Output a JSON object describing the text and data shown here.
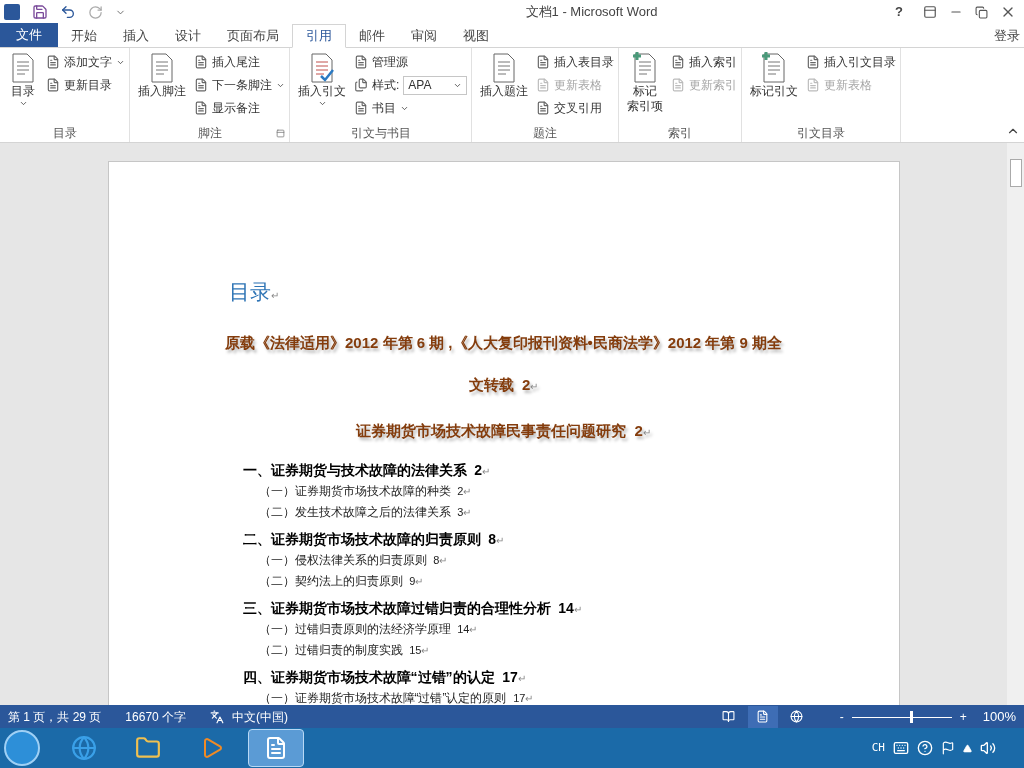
{
  "window": {
    "title": "文档1 - Microsoft Word",
    "help": "?"
  },
  "file_tab": "文件",
  "tabs": [
    {
      "label": "开始",
      "selected": false
    },
    {
      "label": "插入",
      "selected": false
    },
    {
      "label": "设计",
      "selected": false
    },
    {
      "label": "页面布局",
      "selected": false
    },
    {
      "label": "引用",
      "selected": true
    },
    {
      "label": "邮件",
      "selected": false
    },
    {
      "label": "审阅",
      "selected": false
    },
    {
      "label": "视图",
      "selected": false
    }
  ],
  "sign_in": "登录",
  "ribbon_groups": [
    {
      "label": "目录",
      "items": [
        {
          "kind": "large",
          "label_lines": [
            "目录"
          ],
          "dropdown": true
        },
        {
          "kind": "small",
          "label": "添加文字",
          "dropdown": true
        },
        {
          "kind": "small",
          "label": "更新目录"
        }
      ]
    },
    {
      "label": "脚注",
      "launcher": true,
      "items": [
        {
          "kind": "large",
          "label_lines": [
            "插入脚注"
          ]
        },
        {
          "kind": "small",
          "label": "插入尾注"
        },
        {
          "kind": "small",
          "label": "下一条脚注",
          "dropdown": true
        },
        {
          "kind": "small",
          "label": "显示备注"
        }
      ]
    },
    {
      "label": "引文与书目",
      "items": [
        {
          "kind": "large",
          "label_lines": [
            "插入引文"
          ],
          "dropdown": true
        },
        {
          "kind": "small",
          "label": "管理源"
        },
        {
          "kind": "select",
          "label": "样式:",
          "value": "APA"
        },
        {
          "kind": "small",
          "label": "书目",
          "dropdown": true
        }
      ]
    },
    {
      "label": "题注",
      "items": [
        {
          "kind": "large",
          "label_lines": [
            "插入题注"
          ]
        },
        {
          "kind": "small",
          "label": "插入表目录"
        },
        {
          "kind": "small",
          "label": "更新表格",
          "disabled": true
        },
        {
          "kind": "small",
          "label": "交叉引用"
        }
      ]
    },
    {
      "label": "索引",
      "items": [
        {
          "kind": "large",
          "label_lines": [
            "标记",
            "索引项"
          ]
        },
        {
          "kind": "small",
          "label": "插入索引"
        },
        {
          "kind": "small",
          "label": "更新索引",
          "disabled": true
        }
      ]
    },
    {
      "label": "引文目录",
      "items": [
        {
          "kind": "large",
          "label_lines": [
            "标记引文"
          ]
        },
        {
          "kind": "small",
          "label": "插入引文目录"
        },
        {
          "kind": "small",
          "label": "更新表格",
          "disabled": true
        }
      ]
    }
  ],
  "document": {
    "heading": "目录",
    "paragraph_mark": "↵",
    "toc": [
      {
        "text": "原载《法律适用》2012 年第 6 期 ,《人大复印报刊资料•民商法学》2012 年第 9 期全文转载",
        "page": "2"
      },
      {
        "text": "证券期货市场技术故障民事责任问题研究",
        "page": "2",
        "children": [
          {
            "text": "一、证券期货与技术故障的法律关系",
            "page": "2",
            "children": [
              {
                "text": "（一）证券期货市场技术故障的种类",
                "page": "2"
              },
              {
                "text": "（二）发生技术故障之后的法律关系",
                "page": "3"
              }
            ]
          },
          {
            "text": "二、证券期货市场技术故障的归责原则",
            "page": "8",
            "children": [
              {
                "text": "（一）侵权法律关系的归责原则",
                "page": "8"
              },
              {
                "text": "（二）契约法上的归责原则",
                "page": "9"
              }
            ]
          },
          {
            "text": "三、证券期货市场技术故障过错归责的合理性分析",
            "page": "14",
            "children": [
              {
                "text": "（一）过错归责原则的法经济学原理",
                "page": "14"
              },
              {
                "text": "（二）过错归责的制度实践",
                "page": "15"
              }
            ]
          },
          {
            "text": "四、证券期货市场技术故障“过错”的认定",
            "page": "17",
            "children": [
              {
                "text": "（一）证券期货市场技术故障“过错”认定的原则",
                "page": "17"
              }
            ]
          }
        ]
      }
    ]
  },
  "status_bar": {
    "page": "第 1 页，共 29 页",
    "words": "16670 个字",
    "language": "中文(中国)",
    "views": [
      {
        "selected": false
      },
      {
        "selected": true
      },
      {
        "selected": false
      }
    ],
    "zoom_minus": "-",
    "zoom_plus": "+",
    "zoom": {
      "level": 0.6
    },
    "zoom_text": "100%"
  },
  "taskbar": {
    "apps": [
      {
        "kind": "ie",
        "selected": false
      },
      {
        "kind": "explorer",
        "selected": false
      },
      {
        "kind": "media",
        "selected": false
      },
      {
        "kind": "word",
        "selected": true
      }
    ],
    "input_language": "CH"
  }
}
